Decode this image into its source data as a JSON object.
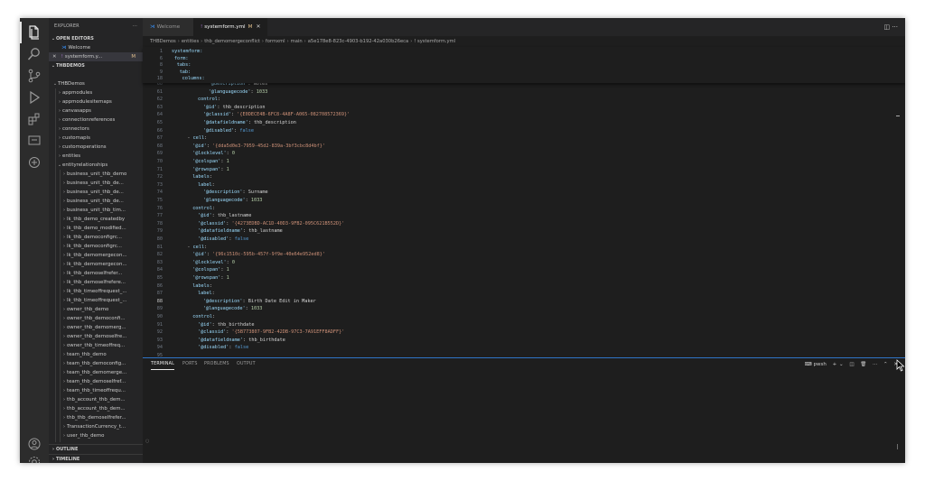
{
  "sidebar": {
    "title": "EXPLORER",
    "more": "···",
    "open_editors_label": "OPEN EDITORS",
    "open_editors": [
      {
        "name": "Welcome",
        "icon": "vscode-icon"
      },
      {
        "name": "systemform.y...",
        "icon": "yml-icon",
        "badge": "M",
        "close": "✕"
      }
    ],
    "workspace_label": "THBDEMOS",
    "root_folder": "THBDemos",
    "folders": [
      "appmodules",
      "appmodulesitemaps",
      "canvasapps",
      "connectionreferences",
      "connectors",
      "customapis",
      "customoperations",
      "entities",
      "entityrelationships"
    ],
    "relationships": [
      "business_unit_thb_demo",
      "business_unit_thb_de...",
      "business_unit_thb_de...",
      "business_unit_thb_de...",
      "business_unit_thb_tim...",
      "lk_thb_demo_createdby",
      "lk_thb_demo_modified...",
      "lk_thb_democonfigrc...",
      "lk_thb_democonfigrc...",
      "lk_thb_demomergecon...",
      "lk_thb_demomergecon...",
      "lk_thb_demoselfrefer...",
      "lk_thb_demoselfrefere...",
      "lk_thb_timeoffrequest_...",
      "lk_thb_timeoffrequest_...",
      "owner_thb_demo",
      "owner_thb_democonfi...",
      "owner_thb_demomerg...",
      "owner_thb_demoselfre...",
      "owner_thb_timeoffreq...",
      "team_thb_demo",
      "team_thb_democonfig...",
      "team_thb_demomerge...",
      "team_thb_demoselfref...",
      "team_thb_timeoffrequ...",
      "thb_account_thb_dem...",
      "thb_account_thb_dem...",
      "thb_thb_demoselfrefer...",
      "TransactionCurrency_t...",
      "user_thb_demo",
      "user_thb_democonfigr...",
      "user_thb_demomerge..."
    ],
    "outline_label": "OUTLINE",
    "timeline_label": "TIMELINE"
  },
  "tabs": [
    {
      "label": "Welcome",
      "icon": "vscode-icon"
    },
    {
      "label": "systemform.yml",
      "badge": "M",
      "icon": "yml-icon",
      "close": "✕"
    }
  ],
  "tab_actions": "◫ ···",
  "breadcrumb": [
    "THBDemos",
    "entities",
    "thb_demomergeconflict",
    "formxml",
    "main",
    "a5e178e8-823c-4903-b192-42a030b26eca",
    "! systemform.yml"
  ],
  "sticky_lines": [
    {
      "n": "1",
      "indent": 0,
      "text": "systemform:"
    },
    {
      "n": "6",
      "indent": 1,
      "text": "form:"
    },
    {
      "n": "8",
      "indent": 2,
      "text": "tabs:"
    },
    {
      "n": "9",
      "indent": 3,
      "text": "tab:"
    },
    {
      "n": "18",
      "indent": 4,
      "text": "columns:"
    }
  ],
  "code_lines": [
    {
      "n": "60",
      "indent": 14,
      "key": "'@description'",
      "val": "Notes",
      "vt": "p"
    },
    {
      "n": "61",
      "indent": 14,
      "key": "'@languagecode'",
      "val": "1033",
      "vt": "n"
    },
    {
      "n": "62",
      "indent": 10,
      "key": "control",
      "val": "",
      "vt": "p"
    },
    {
      "n": "63",
      "indent": 12,
      "key": "'@id'",
      "val": "thb_description",
      "vt": "p"
    },
    {
      "n": "64",
      "indent": 12,
      "key": "'@classid'",
      "val": "'{E0DECE4B-6FC8-4A8F-A065-082708572369}'",
      "vt": "s"
    },
    {
      "n": "65",
      "indent": 12,
      "key": "'@datafieldname'",
      "val": "thb_description",
      "vt": "p"
    },
    {
      "n": "66",
      "indent": 12,
      "key": "'@disabled'",
      "val": "false",
      "vt": "k"
    },
    {
      "n": "67",
      "indent": 6,
      "key": "cell",
      "val": "",
      "vt": "p",
      "dash": true
    },
    {
      "n": "68",
      "indent": 8,
      "key": "'@id'",
      "val": "'{dda5d0e3-7959-45d2-839a-3bf3cbc8d4bf}'",
      "vt": "s"
    },
    {
      "n": "69",
      "indent": 8,
      "key": "'@locklevel'",
      "val": "0",
      "vt": "n"
    },
    {
      "n": "70",
      "indent": 8,
      "key": "'@colspan'",
      "val": "1",
      "vt": "n"
    },
    {
      "n": "71",
      "indent": 8,
      "key": "'@rowspan'",
      "val": "1",
      "vt": "n"
    },
    {
      "n": "72",
      "indent": 8,
      "key": "labels",
      "val": "",
      "vt": "p"
    },
    {
      "n": "73",
      "indent": 10,
      "key": "label",
      "val": "",
      "vt": "p"
    },
    {
      "n": "74",
      "indent": 12,
      "key": "'@description'",
      "val": "Surname",
      "vt": "p"
    },
    {
      "n": "75",
      "indent": 12,
      "key": "'@languagecode'",
      "val": "1033",
      "vt": "n"
    },
    {
      "n": "76",
      "indent": 8,
      "key": "control",
      "val": "",
      "vt": "p"
    },
    {
      "n": "77",
      "indent": 10,
      "key": "'@id'",
      "val": "thb_lastname",
      "vt": "p"
    },
    {
      "n": "78",
      "indent": 10,
      "key": "'@classid'",
      "val": "'{4273EDBD-AC1D-40D3-9FB2-095C621B552D}'",
      "vt": "s"
    },
    {
      "n": "79",
      "indent": 10,
      "key": "'@datafieldname'",
      "val": "thb_lastname",
      "vt": "p"
    },
    {
      "n": "80",
      "indent": 10,
      "key": "'@disabled'",
      "val": "false",
      "vt": "k"
    },
    {
      "n": "81",
      "indent": 6,
      "key": "cell",
      "val": "",
      "vt": "p",
      "dash": true
    },
    {
      "n": "82",
      "indent": 8,
      "key": "'@id'",
      "val": "'{96c1510c-595b-457f-9f9e-40e64e952ed8}'",
      "vt": "s"
    },
    {
      "n": "83",
      "indent": 8,
      "key": "'@locklevel'",
      "val": "0",
      "vt": "n"
    },
    {
      "n": "84",
      "indent": 8,
      "key": "'@colspan'",
      "val": "1",
      "vt": "n"
    },
    {
      "n": "85",
      "indent": 8,
      "key": "'@rowspan'",
      "val": "1",
      "vt": "n"
    },
    {
      "n": "86",
      "indent": 8,
      "key": "labels",
      "val": "",
      "vt": "p"
    },
    {
      "n": "87",
      "indent": 10,
      "key": "label",
      "val": "",
      "vt": "p"
    },
    {
      "n": "88",
      "indent": 12,
      "key": "'@description'",
      "val": "Birth Date Edit in Maker",
      "vt": "p",
      "current": true
    },
    {
      "n": "89",
      "indent": 12,
      "key": "'@languagecode'",
      "val": "1033",
      "vt": "n"
    },
    {
      "n": "90",
      "indent": 8,
      "key": "control",
      "val": "",
      "vt": "p"
    },
    {
      "n": "91",
      "indent": 10,
      "key": "'@id'",
      "val": "thb_birthdate",
      "vt": "p"
    },
    {
      "n": "92",
      "indent": 10,
      "key": "'@classid'",
      "val": "'{5B773807-9FB2-42DB-97C3-7A91EFF8ADFF}'",
      "vt": "s"
    },
    {
      "n": "93",
      "indent": 10,
      "key": "'@datafieldname'",
      "val": "thb_birthdate",
      "vt": "p"
    },
    {
      "n": "94",
      "indent": 10,
      "key": "'@disabled'",
      "val": "false",
      "vt": "k"
    },
    {
      "n": "95",
      "indent": 8,
      "key": "",
      "val": "",
      "vt": "p"
    }
  ],
  "panel": {
    "tabs": [
      "TERMINAL",
      "PORTS",
      "PROBLEMS",
      "OUTPUT"
    ],
    "active_tab": "TERMINAL",
    "shell": "pwsh",
    "actions": [
      "+",
      "⌄",
      "◫",
      "🗑",
      "···",
      "⌃",
      "✕"
    ]
  },
  "colors": {
    "accent": "#2f75c7",
    "modified": "#e2c08d",
    "yml": "#a074c4"
  }
}
